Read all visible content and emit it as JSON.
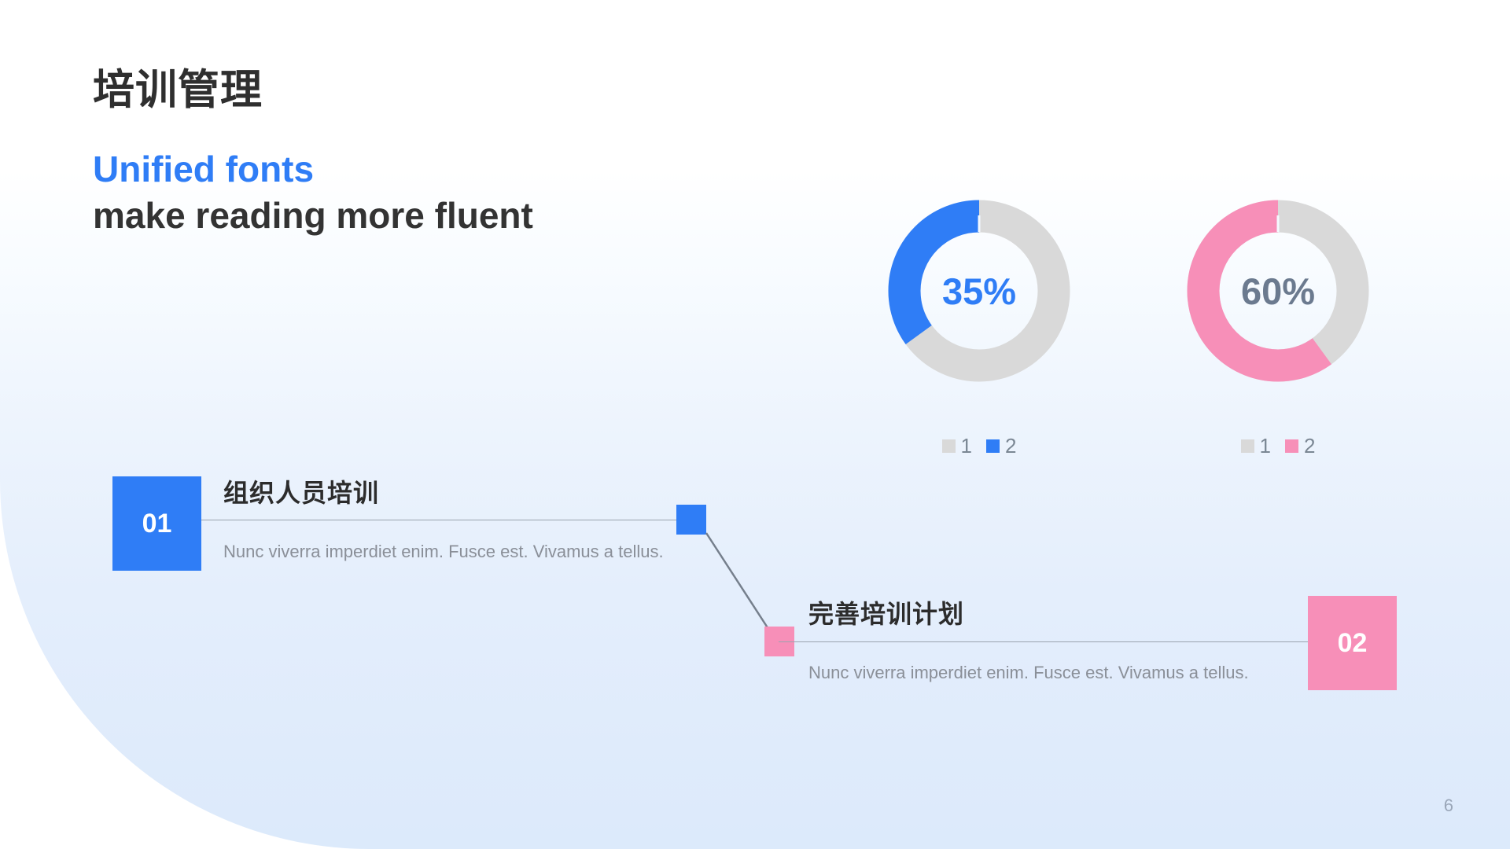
{
  "slide": {
    "title_cn": "培训管理",
    "headline_line1": "Unified fonts",
    "headline_line2": "make reading more fluent",
    "page_number": "6"
  },
  "colors": {
    "accent_blue": "#2f7df6",
    "accent_pink": "#f78fb8",
    "track_gray": "#d9d9d9",
    "text_dark": "#2c2c2c",
    "text_muted": "#8a8f98",
    "bg_gradient_bottom": "#dceafb"
  },
  "charts": [
    {
      "name": "blue-donut",
      "center_label": "35%",
      "center_color": "#2f7df6",
      "legend": [
        {
          "label": "1",
          "swatch": "sw-gray"
        },
        {
          "label": "2",
          "swatch": "sw-blue"
        }
      ]
    },
    {
      "name": "pink-donut",
      "center_label": "60%",
      "center_color": "#6b7a8f",
      "legend": [
        {
          "label": "1",
          "swatch": "sw-gray"
        },
        {
          "label": "2",
          "swatch": "sw-pink"
        }
      ]
    }
  ],
  "items": [
    {
      "number": "01",
      "heading": "组织人员培训",
      "body": "Nunc viverra imperdiet enim. Fusce est. Vivamus a tellus."
    },
    {
      "number": "02",
      "heading": "完善培训计划",
      "body": "Nunc viverra imperdiet enim. Fusce est. Vivamus a tellus."
    }
  ],
  "chart_data": [
    {
      "type": "pie",
      "title": "35%",
      "categories": [
        "1",
        "2"
      ],
      "values": [
        65,
        35
      ],
      "colors": [
        "#d9d9d9",
        "#2f7df6"
      ],
      "donut": true,
      "hole_ratio": 0.66,
      "start_angle_deg": 0,
      "direction": "counterclockwise",
      "legend_position": "bottom",
      "labels": [
        "1",
        "2"
      ],
      "center_text": "35%",
      "xlabel": "",
      "ylabel": ""
    },
    {
      "type": "pie",
      "title": "60%",
      "categories": [
        "1",
        "2"
      ],
      "values": [
        40,
        60
      ],
      "colors": [
        "#d9d9d9",
        "#f78fb8"
      ],
      "donut": true,
      "hole_ratio": 0.66,
      "start_angle_deg": 0,
      "direction": "counterclockwise",
      "legend_position": "bottom",
      "labels": [
        "1",
        "2"
      ],
      "center_text": "60%",
      "xlabel": "",
      "ylabel": ""
    }
  ]
}
